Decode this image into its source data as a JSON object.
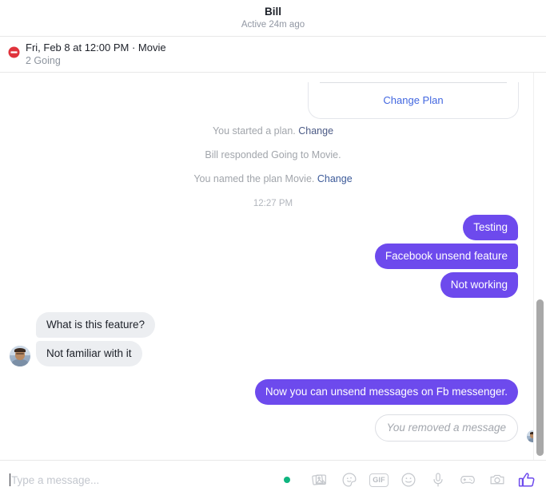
{
  "header": {
    "title": "Bill",
    "status": "Active 24m ago"
  },
  "event_banner": {
    "icon": "event-circle-icon",
    "icon_color": "#e0333c",
    "title": "Fri, Feb 8 at 12:00 PM · Movie",
    "subtitle": "2 Going"
  },
  "plan_card": {
    "action_label": "Change Plan",
    "action_color": "#4267e0"
  },
  "system_messages": [
    {
      "text": "You started a plan. ",
      "link": "Change"
    },
    {
      "text": "Bill responded Going to Movie.",
      "link": ""
    },
    {
      "text": "You named the plan Movie. ",
      "link": "Change"
    }
  ],
  "timestamp": "12:27 PM",
  "messages": [
    {
      "side": "out",
      "group": "top",
      "text": "Testing"
    },
    {
      "side": "out",
      "group": "mid",
      "text": "Facebook unsend feature"
    },
    {
      "side": "out",
      "group": "bottom",
      "text": "Not working"
    },
    {
      "side": "in",
      "group": "top",
      "text": "What is this feature?"
    },
    {
      "side": "in",
      "group": "bottom",
      "text": "Not familiar with it"
    },
    {
      "side": "out",
      "group": "single",
      "text": "Now you can unsend messages on Fb messenger."
    },
    {
      "side": "out",
      "group": "removed",
      "text": "You removed a message"
    }
  ],
  "bubble_colors": {
    "outgoing": "#6d4aed",
    "incoming": "#eceef1",
    "outgoing_text": "#ffffff",
    "incoming_text": "#1d2129"
  },
  "read_receipt": {
    "icon": "check-circle-icon",
    "color": "#6d4aed"
  },
  "composer": {
    "placeholder": "Type a message...",
    "value": "",
    "status_dot_color": "#0fb57f",
    "gif_label": "GIF",
    "icons": [
      "photo-icon",
      "sticker-icon",
      "gif-icon",
      "emoji-icon",
      "microphone-icon",
      "gamepad-icon",
      "camera-icon",
      "thumbs-up-icon"
    ],
    "thumbs_up_color": "#6d4aed"
  }
}
